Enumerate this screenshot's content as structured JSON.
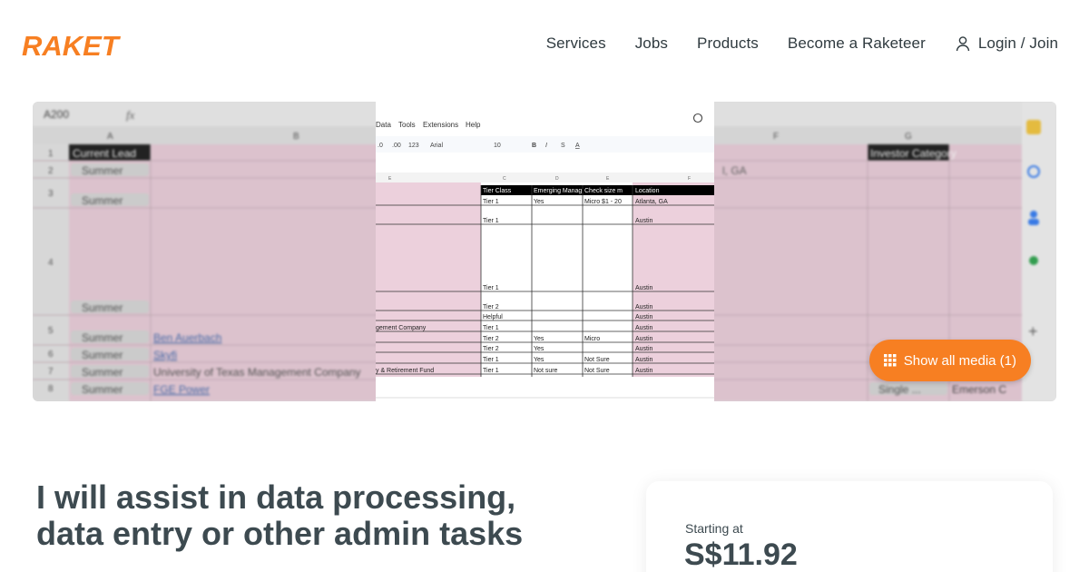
{
  "header": {
    "logo_text": "RAKET",
    "brand_color": "#f77f22",
    "nav": [
      {
        "label": "Services"
      },
      {
        "label": "Jobs"
      },
      {
        "label": "Products"
      },
      {
        "label": "Become a Raketeer"
      }
    ],
    "login_label": "Login / Join",
    "login_icon": "user-icon"
  },
  "media": {
    "show_all_label": "Show all media (1)",
    "sheet": {
      "cell_ref": "A200",
      "formula_icon": "fx",
      "col_a": "A",
      "col_b": "B",
      "col_f": "F",
      "col_g": "G",
      "header_a": "Current Lead",
      "header_g": "Investor Category",
      "rows": [
        "1",
        "2",
        "3",
        "4",
        "5",
        "6",
        "7",
        "8"
      ],
      "leads": [
        "Summer",
        "Summer",
        "Summer",
        "Summer",
        "Summer",
        "Summer",
        "Summer"
      ],
      "names": [
        "Ben Auerbach",
        "Skyfi",
        "University of Texas Management Company",
        "FGE Power"
      ],
      "right_values": [
        "Single ...",
        "Emerson C"
      ],
      "location_fragment": "l, GA"
    },
    "inner_sheet": {
      "menu": [
        "Data",
        "Tools",
        "Extensions",
        "Help"
      ],
      "font": "Arial",
      "font_size": "10",
      "cols": [
        "E",
        "C",
        "D",
        "E",
        "F"
      ],
      "headers": [
        "Tier Class",
        "Emerging Manag",
        "Check size m",
        "Location"
      ],
      "rows": [
        {
          "b": "",
          "c": "Tier 1",
          "d": "Yes",
          "e": "Micro $1 - 20",
          "f": "Atlanta, GA"
        },
        {
          "b": "",
          "c": "Tier 1",
          "d": "",
          "e": "",
          "f": "Austin"
        },
        {
          "b": "",
          "c": "Tier 1",
          "d": "",
          "e": "",
          "f": "Austin"
        },
        {
          "b": "",
          "c": "Tier 2",
          "d": "",
          "e": "",
          "f": "Austin"
        },
        {
          "b": "",
          "c": "Helpful",
          "d": "",
          "e": "",
          "f": "Austin"
        },
        {
          "b": "gement Company",
          "c": "Tier 1",
          "d": "",
          "e": "",
          "f": "Austin"
        },
        {
          "b": "",
          "c": "Tier 2",
          "d": "Yes",
          "e": "Micro",
          "f": "Austin"
        },
        {
          "b": "",
          "c": "Tier 2",
          "d": "Yes",
          "e": "",
          "f": "Austin"
        },
        {
          "b": "",
          "c": "Tier 1",
          "d": "Yes",
          "e": "Not Sure",
          "f": "Austin"
        },
        {
          "b": "y & Retirement Fund",
          "c": "Tier 1",
          "d": "Not sure",
          "e": "Not Sure",
          "f": "Austin"
        }
      ]
    }
  },
  "gig": {
    "title_line1": "I will assist in data processing,",
    "title_line2": "data entry or other admin tasks"
  },
  "pricing": {
    "starting_label": "Starting at",
    "price": "S$11.92"
  }
}
